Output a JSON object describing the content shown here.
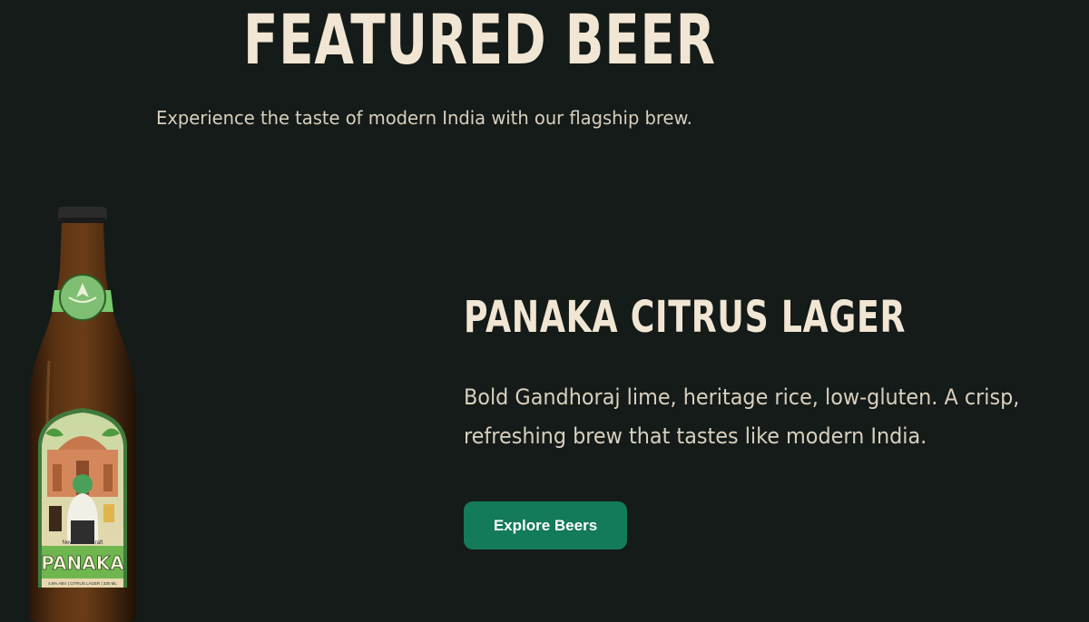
{
  "header": {
    "title": "FEATURED BEER",
    "subtitle": "Experience the taste of modern India with our flagship brew."
  },
  "product": {
    "name": "PANAKA CITRUS LAGER",
    "description_lines": [
      "Bold Gandhoraj lime, heritage rice, low-gluten. A crisp,",
      "refreshing brew that tastes like modern India."
    ],
    "cta_label": "Explore Beers",
    "label": {
      "brand": "PANAKA",
      "tagline": "New Indian Craft",
      "specs": "4.8% ABV | CITRUS LAGER | 330 ML"
    }
  },
  "colors": {
    "background": "#141b19",
    "heading": "#f1e6d3",
    "body_text": "#d9cfbd",
    "button": "#137a5a",
    "button_text": "#ffffff",
    "label_green": "#8fc97a"
  }
}
